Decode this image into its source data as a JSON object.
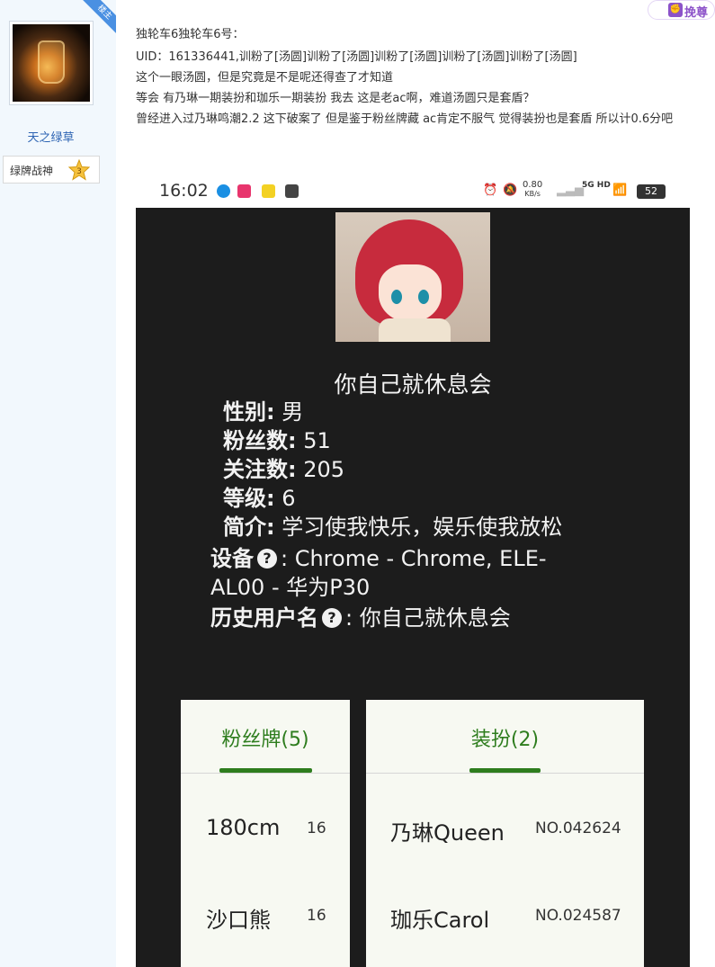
{
  "user": {
    "ribbon": "楼主",
    "name": "天之绿草",
    "badge_label": "绿牌战神",
    "badge_level": "3"
  },
  "topbar": {
    "button_label": "挽尊",
    "button_icon": "fist-icon"
  },
  "post": {
    "lines": [
      "独轮车6独轮车6号：",
      "UID：161336441,训粉了[汤圆]训粉了[汤圆]训粉了[汤圆]训粉了[汤圆]训粉了[汤圆]",
      "这个一眼汤圆，但是究竟是不是呢还得查了才知道",
      "等会 有乃琳一期装扮和珈乐一期装扮 我去 这是老ac啊，难道汤圆只是套盾？",
      "曾经进入过乃琳鸣潮2.2 这下破案了 但是鉴于粉丝牌藏 ac肯定不服气 觉得装扮也是套盾 所以计0.6分吧"
    ]
  },
  "screenshot": {
    "status": {
      "time": "16:02",
      "speed": "0.80",
      "speed_unit": "KB/s",
      "network": "5G HD",
      "battery": "52"
    },
    "profile": {
      "nickname": "你自己就休息会",
      "gender_label": "性别:",
      "gender": "男",
      "fans_label": "粉丝数:",
      "fans": "51",
      "following_label": "关注数:",
      "following": "205",
      "level_label": "等级:",
      "level": "6",
      "bio_label": "简介:",
      "bio": "学习使我快乐，娱乐使我放松",
      "device_label": "设备",
      "device_line1": ": Chrome - Chrome, ELE-",
      "device_line2": "AL00 - 华为P30",
      "history_label": "历史用户名",
      "history": ": 你自己就休息会",
      "help_glyph": "?"
    },
    "medals": {
      "title": "粉丝牌(5)",
      "items": [
        {
          "name": "180cm",
          "level": "16"
        },
        {
          "name": "沙口熊",
          "level": "16"
        }
      ]
    },
    "dress": {
      "title": "装扮(2)",
      "items": [
        {
          "name": "乃琳Queen",
          "no": "NO.042624"
        },
        {
          "name": "珈乐Carol",
          "no": "NO.024587"
        }
      ]
    }
  },
  "colors": {
    "accent_green": "#2e7d1e",
    "link_blue": "#2d64b3",
    "ribbon_blue": "#4a90e2",
    "purple": "#8c52c9"
  }
}
